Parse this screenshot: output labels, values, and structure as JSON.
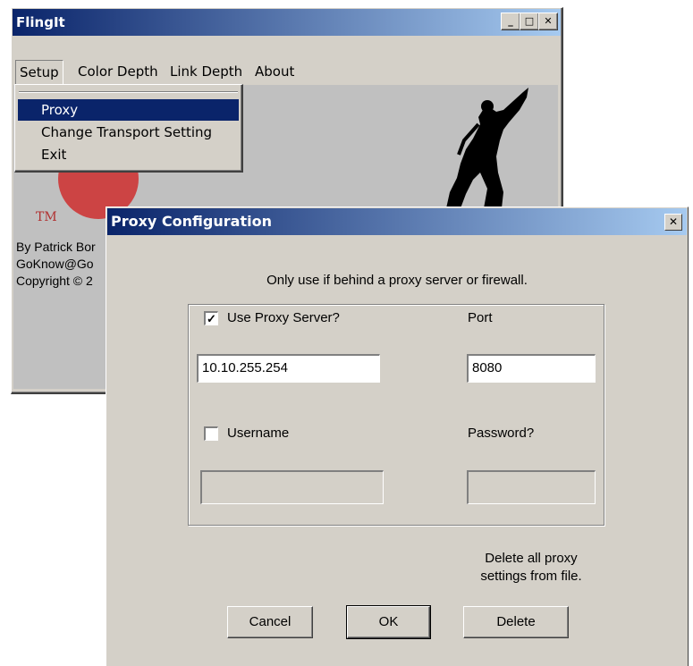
{
  "main_window": {
    "title": "FlingIt",
    "menu": [
      "Setup",
      "Color Depth",
      "Link Depth",
      "About"
    ],
    "tm": "TM",
    "author_lines": [
      "By Patrick Bor",
      "GoKnow@Go",
      "Copyright © 2"
    ]
  },
  "setup_menu": {
    "items": [
      "Proxy",
      "Change Transport Setting",
      "Exit"
    ],
    "selected": "Proxy"
  },
  "proxy_dialog": {
    "title": "Proxy Configuration",
    "note": "Only use if behind a proxy server or firewall.",
    "use_proxy_label": "Use Proxy Server?",
    "use_proxy_checked": true,
    "port_label": "Port",
    "server_value": "10.10.255.254",
    "port_value": "8080",
    "username_label": "Username",
    "username_checked": false,
    "password_label": "Password?",
    "delete_note": [
      "Delete all proxy",
      "settings from file."
    ],
    "buttons": {
      "cancel": "Cancel",
      "ok": "OK",
      "delete": "Delete"
    }
  },
  "colors": {
    "titlebar": "#0a246a",
    "face": "#d4d0c8",
    "client": "#c0c0c0",
    "logo_red": "#cc4444"
  }
}
